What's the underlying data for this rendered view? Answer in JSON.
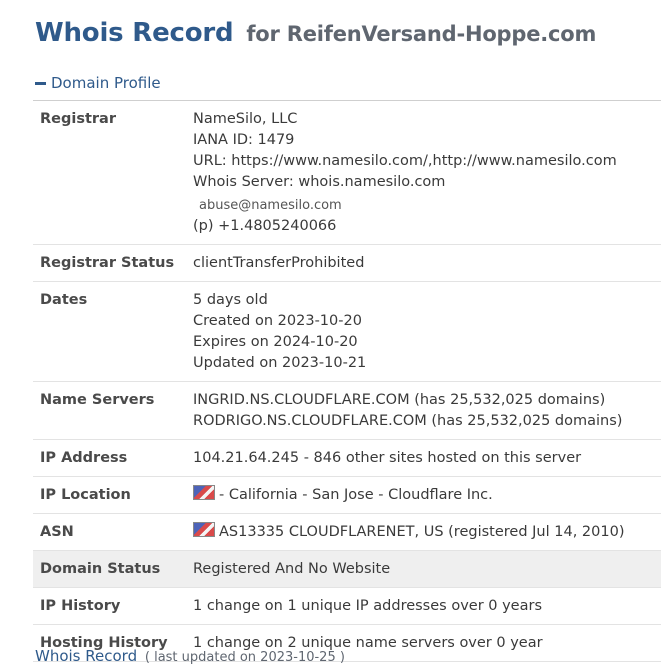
{
  "header": {
    "title": "Whois Record",
    "for_text": "for ReifenVersand-Hoppe.com"
  },
  "section": {
    "label": "Domain Profile"
  },
  "rows": {
    "registrar": {
      "label": "Registrar",
      "name": "NameSilo, LLC",
      "iana": "IANA ID: 1479",
      "url": "URL: https://www.namesilo.com/,http://www.namesilo.com",
      "whois_server": "Whois Server: whois.namesilo.com",
      "email": "abuse@namesilo.com",
      "phone": "(p) +1.4805240066"
    },
    "registrar_status": {
      "label": "Registrar Status",
      "value": "clientTransferProhibited"
    },
    "dates": {
      "label": "Dates",
      "age": "5 days old",
      "created": "Created on 2023-10-20",
      "expires": "Expires on 2024-10-20",
      "updated": "Updated on 2023-10-21"
    },
    "name_servers": {
      "label": "Name Servers",
      "ns1": "INGRID.NS.CLOUDFLARE.COM (has 25,532,025 domains)",
      "ns2": "RODRIGO.NS.CLOUDFLARE.COM (has 25,532,025 domains)"
    },
    "ip_address": {
      "label": "IP Address",
      "value": "104.21.64.245 - 846 other sites hosted on this server"
    },
    "ip_location": {
      "label": "IP Location",
      "value": "- California - San Jose - Cloudflare Inc."
    },
    "asn": {
      "label": "ASN",
      "value": "AS13335 CLOUDFLARENET, US (registered Jul 14, 2010)"
    },
    "domain_status": {
      "label": "Domain Status",
      "value": "Registered And No Website"
    },
    "ip_history": {
      "label": "IP History",
      "value": "1 change on 1 unique IP addresses over 0 years"
    },
    "hosting_history": {
      "label": "Hosting History",
      "value": "1 change on 2 unique name servers over 0 year"
    }
  },
  "footer": {
    "link": "Whois Record",
    "note": "( last updated on 2023-10-25 )"
  },
  "colors": {
    "accent": "#2f5a8b",
    "shaded_row": "#efefef"
  },
  "icons": {
    "section_toggle": "minus-icon",
    "flag": "us-flag-icon"
  }
}
